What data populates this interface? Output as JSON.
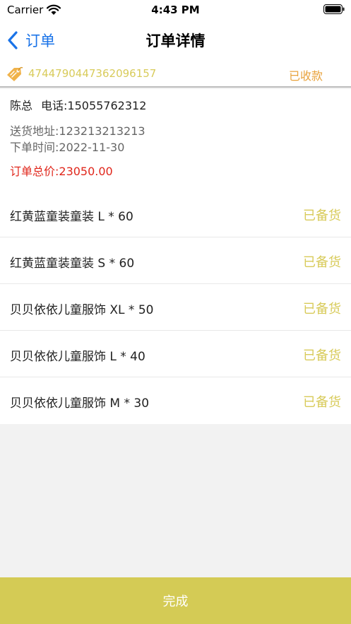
{
  "status_bar": {
    "carrier": "Carrier",
    "time": "4:43 PM"
  },
  "nav": {
    "back_label": "订单",
    "title": "订单详情"
  },
  "order": {
    "number": "4744790447362096157",
    "status": "已收款"
  },
  "customer": {
    "name": "陈总",
    "phone": "电话:15055762312",
    "address": "送货地址:123213213213",
    "order_time": "下单时间:2022-11-30",
    "total": "订单总价:23050.00"
  },
  "items": [
    {
      "name": "红黄蓝童装童装 L * 60",
      "status": "已备货"
    },
    {
      "name": "红黄蓝童装童装 S * 60",
      "status": "已备货"
    },
    {
      "name": "贝贝依依儿童服饰 XL * 50",
      "status": "已备货"
    },
    {
      "name": "贝贝依依儿童服饰 L * 40",
      "status": "已备货"
    },
    {
      "name": "贝贝依依儿童服饰 M * 30",
      "status": "已备货"
    }
  ],
  "footer": {
    "done_label": "完成"
  },
  "colors": {
    "accent_yellow": "#d8cb5a",
    "status_orange": "#e8a23c",
    "total_red": "#e0261b",
    "link_blue": "#1a73e8",
    "button_bg": "#d4cb55"
  },
  "icons": {
    "back": "chevron-left-icon",
    "tag": "price-tag-icon",
    "wifi": "wifi-icon",
    "battery": "battery-icon"
  }
}
